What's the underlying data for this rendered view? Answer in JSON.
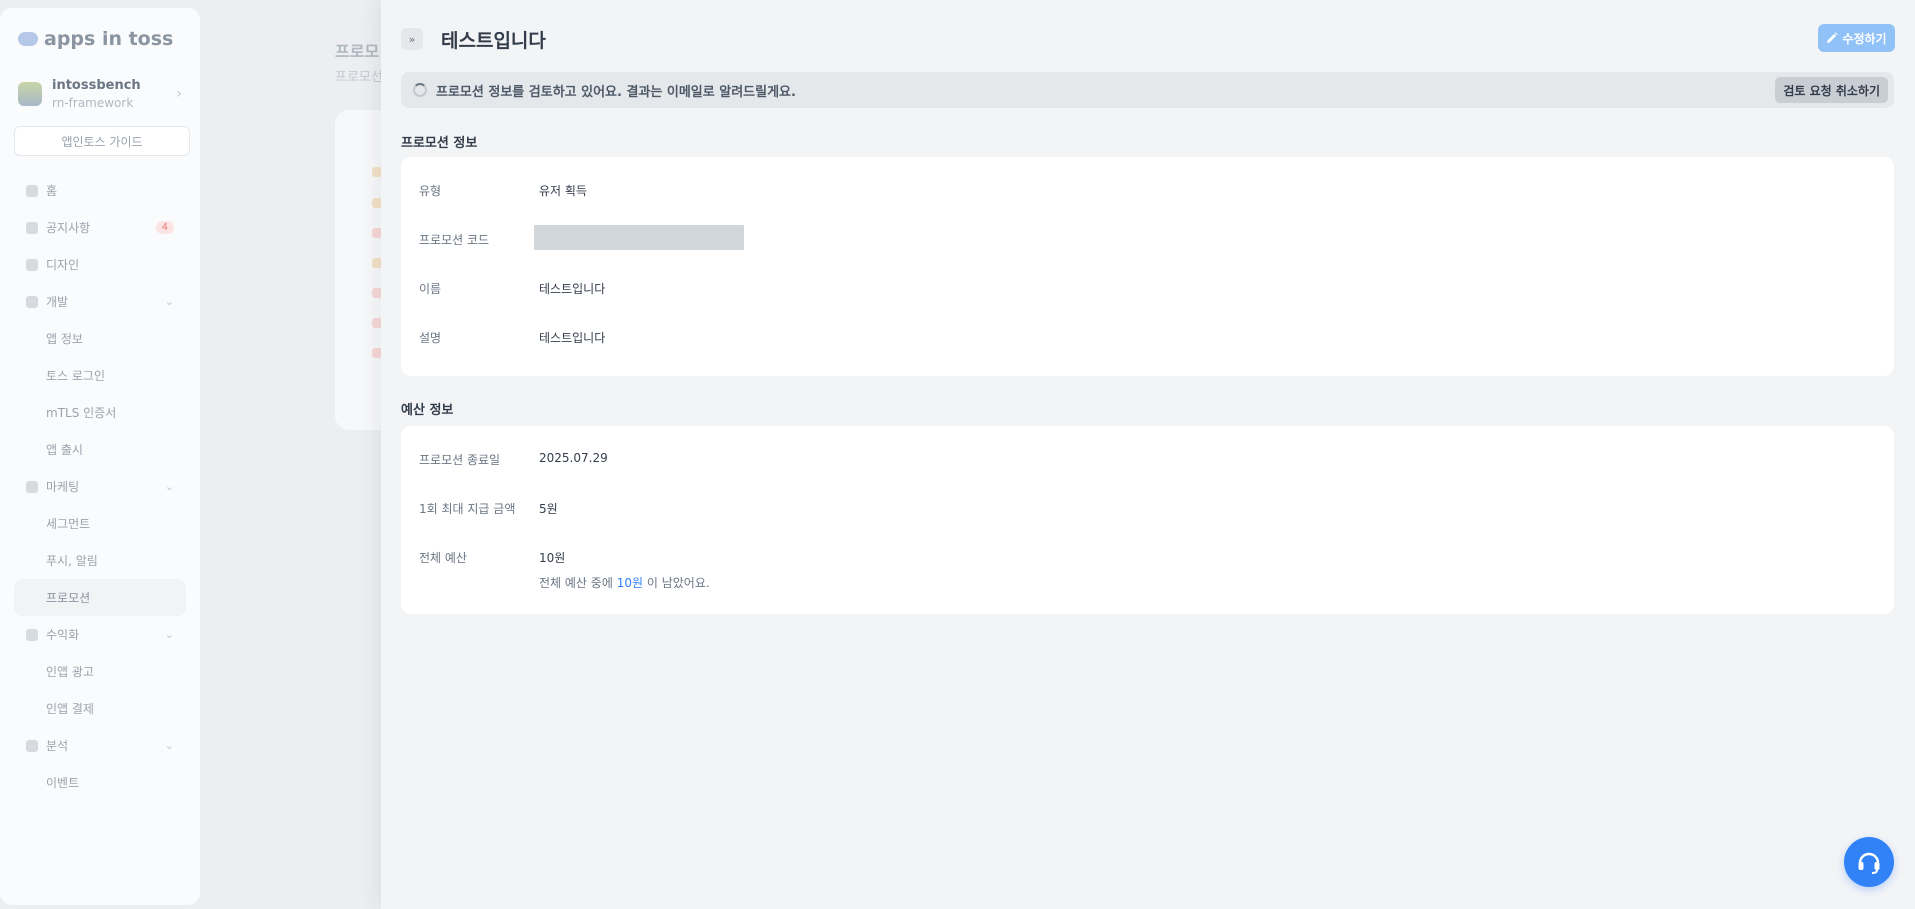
{
  "app": {
    "logo_text": "apps in toss"
  },
  "account": {
    "name": "intossbench",
    "project": "rn-framework"
  },
  "sidebar": {
    "guide_label": "앱인토스 가이드",
    "items": [
      {
        "label": "홈"
      },
      {
        "label": "공지사항",
        "badge": "4"
      },
      {
        "label": "디자인"
      },
      {
        "label": "개발"
      },
      {
        "label": "앱 정보"
      },
      {
        "label": "토스 로그인"
      },
      {
        "label": "mTLS 인증서"
      },
      {
        "label": "앱 출시"
      },
      {
        "label": "마케팅"
      },
      {
        "label": "세그먼트"
      },
      {
        "label": "푸시, 알림"
      },
      {
        "label": "프로모션"
      },
      {
        "label": "수익화"
      },
      {
        "label": "인앱 광고"
      },
      {
        "label": "인앱 결제"
      },
      {
        "label": "분석"
      },
      {
        "label": "이벤트"
      }
    ]
  },
  "background_page": {
    "title": "프로모",
    "subtitle": "프로모선"
  },
  "drawer": {
    "collapse_label": "»",
    "title": "테스트입니다",
    "edit_label": "수정하기",
    "status": {
      "message": "프로모션 정보를 검토하고 있어요. 결과는 이메일로 알려드릴게요.",
      "cancel_label": "검토 요청 취소하기"
    },
    "promotion_info": {
      "title": "프로모션 정보",
      "rows": [
        {
          "label": "유형",
          "value": "유저 획득"
        },
        {
          "label": "프로모션 코드",
          "value": ""
        },
        {
          "label": "이름",
          "value": "테스트입니다"
        },
        {
          "label": "설명",
          "value": "테스트입니다"
        }
      ]
    },
    "budget_info": {
      "title": "예산 정보",
      "rows": [
        {
          "label": "프로모션 종료일",
          "value": "2025.07.29"
        },
        {
          "label": "1회 최대 지급 금액",
          "value": "5원"
        },
        {
          "label": "전체 예산",
          "value": "10원",
          "note_prefix": "전체 예산 중에",
          "note_amount": "10원",
          "note_suffix": "이 남았어요."
        }
      ]
    }
  },
  "colors": {
    "accent": "#3182f6",
    "edit_button": "#90c2f8"
  }
}
